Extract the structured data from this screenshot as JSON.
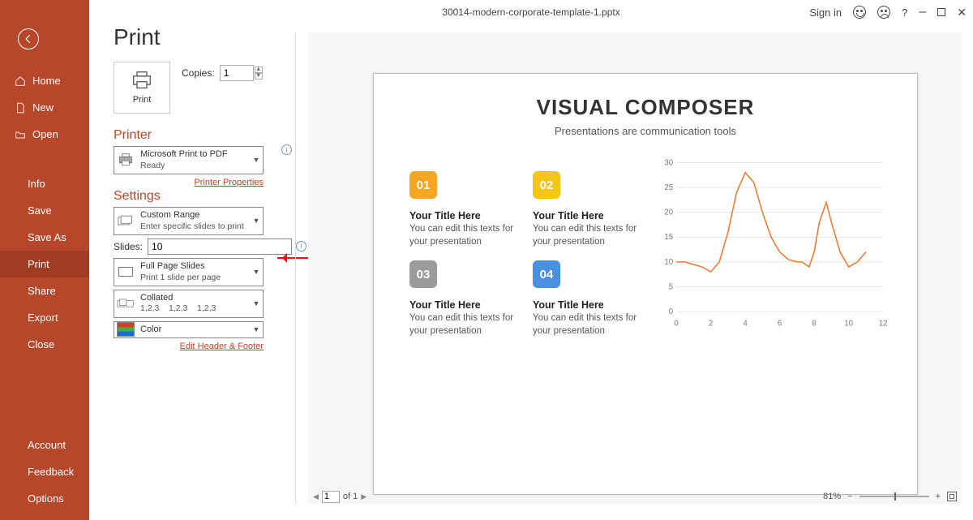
{
  "title_filename": "30014-modern-corporate-template-1.pptx",
  "title_controls": {
    "signin": "Sign in",
    "help": "?"
  },
  "sidebar": {
    "home": "Home",
    "new": "New",
    "open": "Open",
    "info": "Info",
    "save": "Save",
    "saveas": "Save As",
    "print": "Print",
    "share": "Share",
    "export": "Export",
    "close": "Close",
    "account": "Account",
    "feedback": "Feedback",
    "options": "Options"
  },
  "panel": {
    "heading": "Print",
    "print_button": "Print",
    "copies_label": "Copies:",
    "copies_value": "1",
    "printer_heading": "Printer",
    "printer_name": "Microsoft Print to PDF",
    "printer_status": "Ready",
    "printer_props": "Printer Properties",
    "settings_heading": "Settings",
    "range_title": "Custom Range",
    "range_sub": "Enter specific slides to print",
    "slides_label": "Slides:",
    "slides_value": "10",
    "layout_title": "Full Page Slides",
    "layout_sub": "Print 1 slide per page",
    "collate_title": "Collated",
    "collate_sub": "1,2,3    1,2,3    1,2,3",
    "color_title": "Color",
    "edit_hf": "Edit Header & Footer"
  },
  "preview": {
    "slide_title": "VISUAL COMPOSER",
    "slide_sub": "Presentations are communication tools",
    "cells": [
      {
        "num": "01",
        "title": "Your Title Here",
        "desc": "You can edit this texts for your presentation"
      },
      {
        "num": "02",
        "title": "Your Title Here",
        "desc": "You can edit this texts for your presentation"
      },
      {
        "num": "03",
        "title": "Your Title Here",
        "desc": "You can edit this texts for your presentation"
      },
      {
        "num": "04",
        "title": "Your Title Here",
        "desc": "You can edit this texts for your presentation"
      }
    ],
    "page_current": "1",
    "page_of": "of 1",
    "zoom_pct": "81%"
  },
  "chart_data": {
    "type": "line",
    "xlabel": "",
    "ylabel": "",
    "x_ticks": [
      0,
      2,
      4,
      6,
      8,
      10,
      12
    ],
    "y_ticks": [
      0,
      5,
      10,
      15,
      20,
      25,
      30
    ],
    "ylim": [
      0,
      30
    ],
    "xlim": [
      0,
      12
    ],
    "series": [
      {
        "name": "",
        "x": [
          0,
          0.5,
          1,
          1.5,
          2,
          2.5,
          3,
          3.5,
          4,
          4.5,
          5,
          5.5,
          6,
          6.5,
          7,
          7.3,
          7.7,
          8,
          8.3,
          8.7,
          9,
          9.5,
          10,
          10.5,
          11
        ],
        "y": [
          10,
          10,
          9.5,
          9,
          8,
          10,
          16,
          24,
          28,
          26,
          20,
          15,
          12,
          10.5,
          10,
          10,
          9,
          12,
          18,
          22,
          18,
          12,
          9,
          10,
          12
        ]
      }
    ]
  }
}
